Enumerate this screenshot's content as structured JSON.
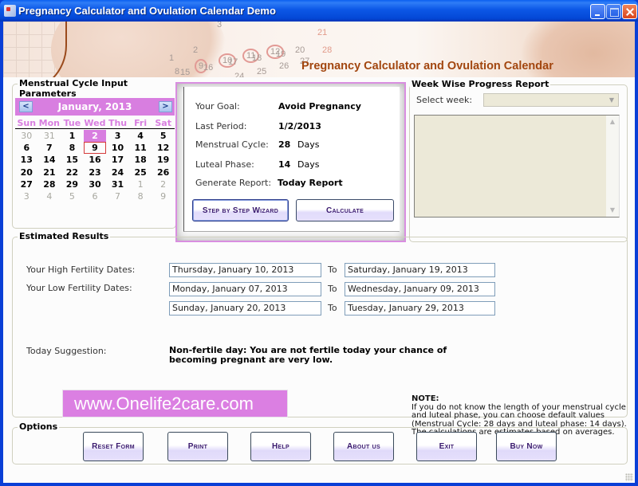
{
  "window": {
    "title": "Pregnancy Calculator and Ovulation Calendar Demo",
    "controls": {
      "minimize": "minimize",
      "maximize": "maximize",
      "close": "close"
    }
  },
  "banner": {
    "title": "Pregnancy Calculator and Ovulation Calendar",
    "decor_numbers": [
      "1",
      "2",
      "3",
      "8",
      "9",
      "10",
      "11",
      "12",
      "15",
      "16",
      "17",
      "18",
      "19",
      "20",
      "21",
      "24",
      "25",
      "26",
      "27",
      "28"
    ]
  },
  "input_group": {
    "label": "Menstrual Cycle Input Parameters",
    "calendar": {
      "month_label": "January, 2013",
      "prev_icon": "<",
      "next_icon": ">",
      "weekdays": [
        "Sun",
        "Mon",
        "Tue",
        "Wed",
        "Thu",
        "Fri",
        "Sat"
      ],
      "weeks": [
        [
          {
            "d": "30",
            "other": true
          },
          {
            "d": "31",
            "other": true
          },
          {
            "d": "1"
          },
          {
            "d": "2",
            "selected": true
          },
          {
            "d": "3"
          },
          {
            "d": "4"
          },
          {
            "d": "5"
          }
        ],
        [
          {
            "d": "6"
          },
          {
            "d": "7"
          },
          {
            "d": "8"
          },
          {
            "d": "9",
            "today": true
          },
          {
            "d": "10"
          },
          {
            "d": "11"
          },
          {
            "d": "12"
          }
        ],
        [
          {
            "d": "13"
          },
          {
            "d": "14"
          },
          {
            "d": "15"
          },
          {
            "d": "16"
          },
          {
            "d": "17"
          },
          {
            "d": "18"
          },
          {
            "d": "19"
          }
        ],
        [
          {
            "d": "20"
          },
          {
            "d": "21"
          },
          {
            "d": "22"
          },
          {
            "d": "23"
          },
          {
            "d": "24"
          },
          {
            "d": "25"
          },
          {
            "d": "26"
          }
        ],
        [
          {
            "d": "27"
          },
          {
            "d": "28"
          },
          {
            "d": "29"
          },
          {
            "d": "30"
          },
          {
            "d": "31"
          },
          {
            "d": "1",
            "other": true
          },
          {
            "d": "2",
            "other": true
          }
        ],
        [
          {
            "d": "3",
            "other": true
          },
          {
            "d": "4",
            "other": true
          },
          {
            "d": "5",
            "other": true
          },
          {
            "d": "6",
            "other": true
          },
          {
            "d": "7",
            "other": true
          },
          {
            "d": "8",
            "other": true
          },
          {
            "d": "9",
            "other": true
          }
        ]
      ]
    }
  },
  "params_panel": {
    "goal_label": "Your Goal:",
    "goal_value": "Avoid Pregnancy",
    "period_label": "Last Period:",
    "period_value": "1/2/2013",
    "cycle_label": "Menstrual Cycle:",
    "cycle_value": "28",
    "cycle_unit": "Days",
    "luteal_label": "Luteal Phase:",
    "luteal_value": "14",
    "luteal_unit": "Days",
    "report_label": "Generate Report:",
    "report_value": "Today Report",
    "wizard_button": "Step by Step Wizard",
    "calculate_button": "Calculate"
  },
  "week_report": {
    "label": "Week Wise Progress Report",
    "select_label": "Select week:",
    "select_value": "",
    "text_value": ""
  },
  "results": {
    "label": "Estimated Results",
    "high_label": "Your High Fertility Dates:",
    "low_label": "Your Low Fertility Dates:",
    "to_label": "To",
    "high_from": "Thursday, January 10, 2013",
    "high_to": "Saturday, January 19, 2013",
    "low1_from": "Monday, January 07, 2013",
    "low1_to": "Wednesday, January 09, 2013",
    "low2_from": "Sunday, January 20, 2013",
    "low2_to": "Tuesday, January 29, 2013",
    "suggestion_label": "Today Suggestion:",
    "suggestion_text": "Non-fertile day: You are not fertile today your chance of becoming pregnant are very low.",
    "brand_url": "www.Onelife2care.com",
    "note_title": "NOTE:",
    "note_text": "If you do not know the length of your menstrual cycle and luteal phase, you can choose default values (Menstrual Cycle: 28 days and luteal phase: 14 days). The calculations are estimates based on averages."
  },
  "options": {
    "label": "Options",
    "buttons": [
      "Reset Form",
      "Print",
      "Help",
      "About us",
      "Exit",
      "Buy Now"
    ]
  },
  "colors": {
    "accent": "#d87ee0",
    "button_text": "#3a1a6e",
    "banner_title": "#a2460f",
    "titlebar": "#0a4fe0"
  }
}
